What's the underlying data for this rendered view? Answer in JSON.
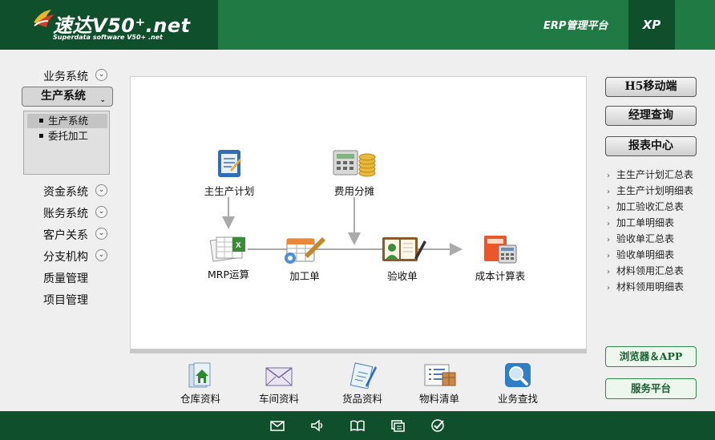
{
  "header": {
    "logo_title": "速达V50⁺.net",
    "logo_subtitle": "Superdata software V50+ .net",
    "platform_label": "ERP管理平台",
    "xp_label": "XP"
  },
  "nav": {
    "items": [
      {
        "label": "业务系统",
        "has_chevron": true
      },
      {
        "label": "生产系统",
        "has_chevron": true,
        "active": true
      },
      {
        "label": "资金系统",
        "has_chevron": true
      },
      {
        "label": "账务系统",
        "has_chevron": true
      },
      {
        "label": "客户关系",
        "has_chevron": true
      },
      {
        "label": "分支机构",
        "has_chevron": true
      },
      {
        "label": "质量管理",
        "has_chevron": false
      },
      {
        "label": "项目管理",
        "has_chevron": false
      }
    ],
    "submenu": [
      {
        "label": "生产系统",
        "selected": true
      },
      {
        "label": "委托加工",
        "selected": false
      }
    ]
  },
  "flow": {
    "nodes": [
      {
        "label": "主生产计划",
        "icon": "plan-icon"
      },
      {
        "label": "费用分摊",
        "icon": "calculator-coins-icon"
      },
      {
        "label": "MRP运算",
        "icon": "mrp-spreadsheet-icon"
      },
      {
        "label": "加工单",
        "icon": "work-order-icon"
      },
      {
        "label": "验收单",
        "icon": "inspection-icon"
      },
      {
        "label": "成本计算表",
        "icon": "cost-calculator-icon"
      }
    ]
  },
  "bottom_tools": [
    {
      "label": "仓库资料",
      "icon": "warehouse-icon"
    },
    {
      "label": "车间资料",
      "icon": "envelope-icon"
    },
    {
      "label": "货品资料",
      "icon": "clipboard-pen-icon"
    },
    {
      "label": "物料清单",
      "icon": "list-box-icon"
    },
    {
      "label": "业务查找",
      "icon": "magnifier-icon"
    }
  ],
  "right": {
    "buttons": [
      "H5移动端",
      "经理查询",
      "报表中心"
    ],
    "reports": [
      "主生产计划汇总表",
      "主生产计划明细表",
      "加工验收汇总表",
      "加工单明细表",
      "验收单汇总表",
      "验收单明细表",
      "材料领用汇总表",
      "材料领用明细表"
    ],
    "green_buttons": [
      "浏览器＆APP",
      "服务平台"
    ]
  },
  "footer": {
    "icons": [
      "mail-icon",
      "speaker-icon",
      "book-icon",
      "window-icon",
      "check-icon"
    ]
  },
  "colors": {
    "header_green": "#1f7a44",
    "dark_green": "#0f4f2b",
    "panel_gray": "#efefef"
  }
}
